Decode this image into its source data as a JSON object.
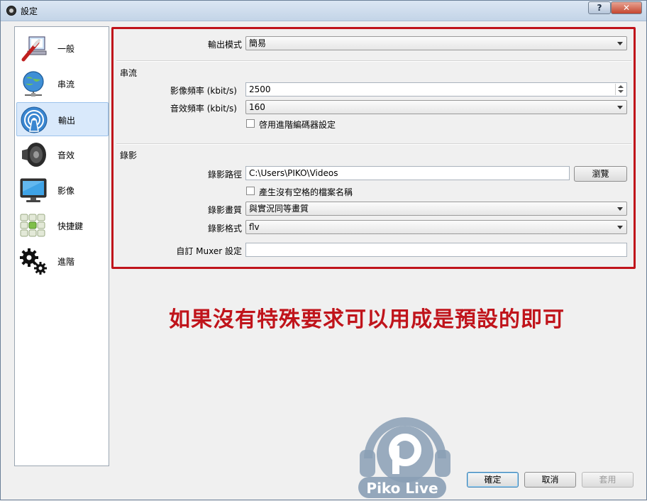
{
  "window": {
    "title": "設定",
    "help_label": "?",
    "close_label": "✕"
  },
  "sidebar": {
    "items": [
      {
        "label": "一般",
        "icon": "general-icon",
        "active": false
      },
      {
        "label": "串流",
        "icon": "globe-network-icon",
        "active": false
      },
      {
        "label": "輸出",
        "icon": "broadcast-icon",
        "active": true
      },
      {
        "label": "音效",
        "icon": "speaker-icon",
        "active": false
      },
      {
        "label": "影像",
        "icon": "monitor-icon",
        "active": false
      },
      {
        "label": "快捷鍵",
        "icon": "keyboard-icon",
        "active": false
      },
      {
        "label": "進階",
        "icon": "gears-icon",
        "active": false
      }
    ]
  },
  "output": {
    "mode_label": "輸出模式",
    "mode_value": "簡易",
    "streaming": {
      "title": "串流",
      "video_bitrate_label": "影像頻率 (kbit/s)",
      "video_bitrate_value": "2500",
      "audio_bitrate_label": "音效頻率 (kbit/s)",
      "audio_bitrate_value": "160",
      "advanced_encoder_label": "啓用進階編碼器設定"
    },
    "recording": {
      "title": "錄影",
      "path_label": "錄影路徑",
      "path_value": "C:\\Users\\PIKO\\Videos",
      "browse_label": "瀏覽",
      "no_space_label": "產生沒有空格的檔案名稱",
      "quality_label": "錄影畫質",
      "quality_value": "與實況同等畫質",
      "format_label": "錄影格式",
      "format_value": "flv",
      "muxer_label": "自訂 Muxer 設定",
      "muxer_value": ""
    }
  },
  "footer": {
    "ok_label": "確定",
    "cancel_label": "取消",
    "apply_label": "套用"
  },
  "annotation": "如果沒有特殊要求可以用成是預設的即可",
  "logo_text": "Piko Live",
  "logo_letter": "P",
  "colors": {
    "annotation": "#c0141b",
    "highlight_border": "#c0141b",
    "active_nav": "#d9e9fb"
  }
}
